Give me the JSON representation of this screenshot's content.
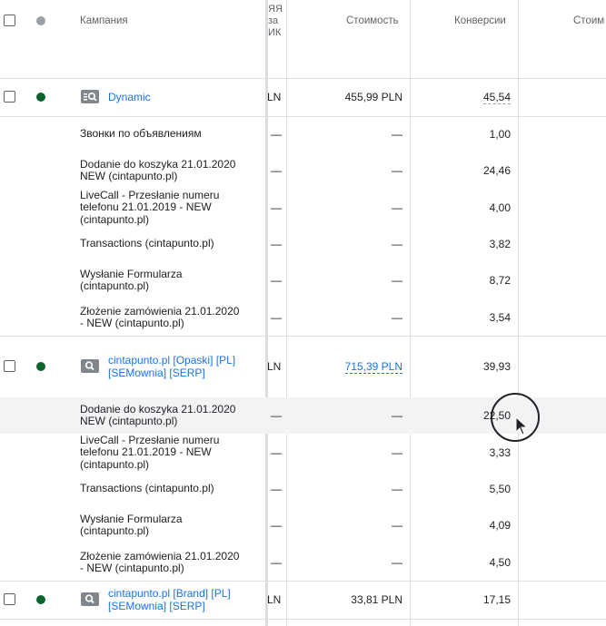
{
  "header": {
    "campaign": "Кампания",
    "clipped_col": [
      "ЯЯ",
      "за",
      "ИК"
    ],
    "cost": "Стоимость",
    "conversions": "Конверсии",
    "cost_per": "Стоим"
  },
  "colors": {
    "status_enabled": "#0d652d",
    "status_header": "#9aa0a6",
    "link": "#1a73e8",
    "icon": "#80868b"
  },
  "rows": [
    {
      "type": "campaign",
      "name": [
        "Dynamic"
      ],
      "clipped": "LN",
      "cost": "455,99 PLN",
      "conv": "45,54",
      "icon": "dynamic-search-icon"
    },
    {
      "type": "sub",
      "label": [
        "Звонки по объявлениям"
      ],
      "dash1": "—",
      "dash2": "—",
      "conv": "1,00"
    },
    {
      "type": "sub",
      "label": [
        "Dodanie do koszyka 21.01.2020",
        "NEW (cintapunto.pl)"
      ],
      "dash1": "—",
      "dash2": "—",
      "conv": "24,46"
    },
    {
      "type": "sub",
      "label": [
        "LiveCall - Przesłanie numeru",
        "telefonu 21.01.2019 - NEW",
        "(cintapunto.pl)"
      ],
      "dash1": "—",
      "dash2": "—",
      "conv": "4,00"
    },
    {
      "type": "sub",
      "label": [
        "Transactions (cintapunto.pl)"
      ],
      "dash1": "—",
      "dash2": "—",
      "conv": "3,82"
    },
    {
      "type": "sub",
      "label": [
        "Wysłanie Formularza",
        "(cintapunto.pl)"
      ],
      "dash1": "—",
      "dash2": "—",
      "conv": "8,72"
    },
    {
      "type": "sub",
      "label": [
        "Złożenie zamówienia 21.01.2020",
        "- NEW (cintapunto.pl)"
      ],
      "dash1": "—",
      "dash2": "—",
      "conv": "3,54"
    },
    {
      "type": "campaign",
      "name": [
        "cintapunto.pl [Opaski] [PL]",
        "[SEMownia] [SERP]"
      ],
      "clipped": "LN",
      "cost": "715,39 PLN",
      "conv": "39,93",
      "icon": "search-icon"
    },
    {
      "type": "sub",
      "label": [
        "Dodanie do koszyka 21.01.2020",
        "NEW (cintapunto.pl)"
      ],
      "dash1": "—",
      "dash2": "—",
      "conv": "22,50"
    },
    {
      "type": "sub",
      "label": [
        "LiveCall - Przesłanie numeru",
        "telefonu 21.01.2019 - NEW",
        "(cintapunto.pl)"
      ],
      "dash1": "—",
      "dash2": "—",
      "conv": "3,33"
    },
    {
      "type": "sub",
      "label": [
        "Transactions (cintapunto.pl)"
      ],
      "dash1": "—",
      "dash2": "—",
      "conv": "5,50"
    },
    {
      "type": "sub",
      "label": [
        "Wysłanie Formularza",
        "(cintapunto.pl)"
      ],
      "dash1": "—",
      "dash2": "—",
      "conv": "4,09"
    },
    {
      "type": "sub",
      "label": [
        "Złożenie zamówienia 21.01.2020",
        "- NEW (cintapunto.pl)"
      ],
      "dash1": "—",
      "dash2": "—",
      "conv": "4,50"
    },
    {
      "type": "campaign",
      "name": [
        "cintapunto.pl [Brand] [PL]",
        "[SEMownia] [SERP]"
      ],
      "clipped": "LN",
      "cost": "33,81 PLN",
      "conv": "17,15",
      "icon": "search-icon"
    }
  ]
}
